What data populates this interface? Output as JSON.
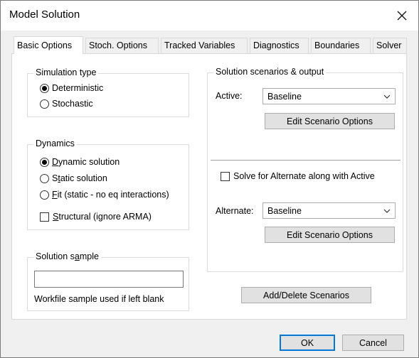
{
  "window": {
    "title": "Model Solution"
  },
  "tabs": [
    {
      "label": "Basic Options",
      "active": true
    },
    {
      "label": "Stoch. Options",
      "active": false
    },
    {
      "label": "Tracked Variables",
      "active": false
    },
    {
      "label": "Diagnostics",
      "active": false
    },
    {
      "label": "Boundaries",
      "active": false
    },
    {
      "label": "Solver",
      "active": false
    }
  ],
  "simulation_type": {
    "title": "Simulation type",
    "options": [
      {
        "label": "Deterministic",
        "selected": true
      },
      {
        "label": "Stochastic",
        "selected": false
      }
    ]
  },
  "dynamics": {
    "title": "Dynamics",
    "options": [
      {
        "pre": "",
        "u": "D",
        "post": "ynamic solution",
        "selected": true
      },
      {
        "pre": "S",
        "u": "t",
        "post": "atic solution",
        "selected": false
      },
      {
        "pre": "",
        "u": "F",
        "post": "it (static - no eq interactions)",
        "selected": false
      }
    ],
    "structural": {
      "u": "S",
      "post": "tructural (ignore ARMA)",
      "checked": false
    }
  },
  "solution_sample": {
    "title_pre": "Solution s",
    "title_u": "a",
    "title_post": "mple",
    "value": "",
    "note": "Workfile sample used if left blank"
  },
  "scenarios": {
    "title": "Solution scenarios & output",
    "active_label": "Active:",
    "active_value": "Baseline",
    "edit_active_label": "Edit Scenario Options",
    "alternate_checkbox_label": "Solve for Alternate along with Active",
    "alternate_checked": false,
    "alternate_label": "Alternate:",
    "alternate_value": "Baseline",
    "edit_alternate_label": "Edit Scenario Options",
    "add_delete_label": "Add/Delete Scenarios"
  },
  "footer": {
    "ok_label": "OK",
    "cancel_label": "Cancel"
  },
  "colors": {
    "focus_border": "#0078d7",
    "dialog_bg": "#f0f0f0",
    "panel_bg": "#ffffff"
  }
}
